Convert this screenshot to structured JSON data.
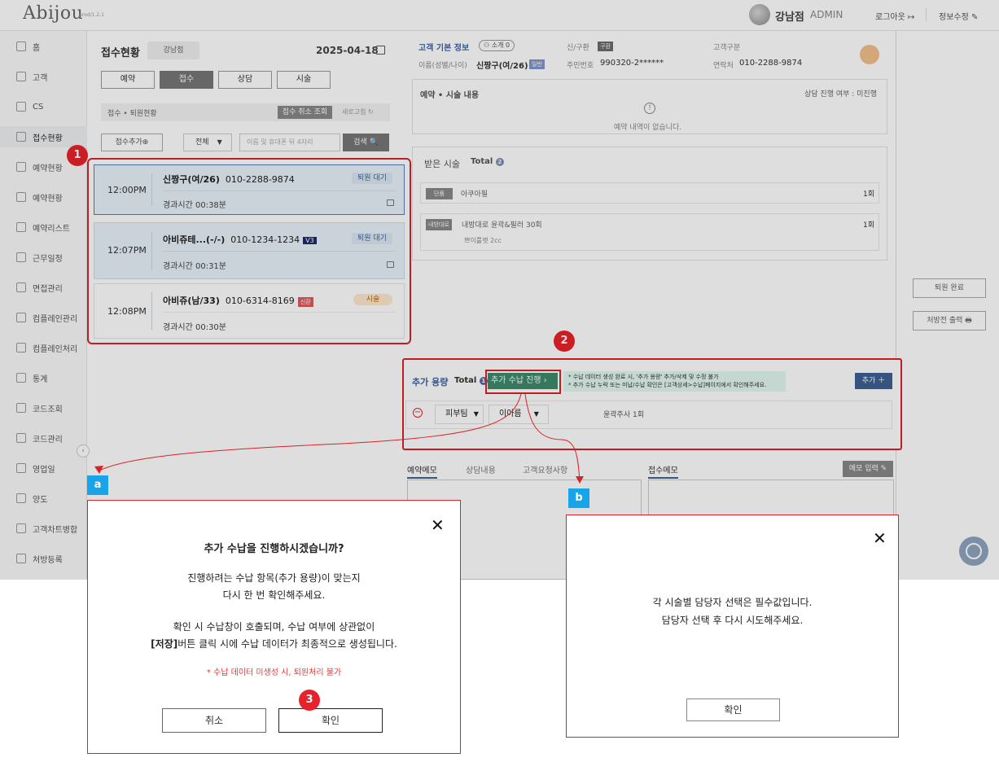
{
  "header": {
    "logo": "Abijou",
    "version": "prod/1.2.1",
    "branch_name": "강남점",
    "role": "ADMIN",
    "logout": "로그아웃 ↦",
    "edit_info": "정보수정 ✎"
  },
  "sidebar": {
    "items": [
      {
        "label": "홈"
      },
      {
        "label": "고객"
      },
      {
        "label": "CS"
      },
      {
        "label": "접수현황"
      },
      {
        "label": "예약현황"
      },
      {
        "label": "예약현황"
      },
      {
        "label": "예약리스트"
      },
      {
        "label": "근무일정"
      },
      {
        "label": "면접관리"
      },
      {
        "label": "컴플레인관리"
      },
      {
        "label": "컴플레인처리"
      },
      {
        "label": "통계"
      },
      {
        "label": "코드조회"
      },
      {
        "label": "코드관리"
      },
      {
        "label": "영업일"
      },
      {
        "label": "양도"
      },
      {
        "label": "고객차트병합"
      },
      {
        "label": "처방등록"
      }
    ],
    "active_index": 3,
    "collapse": "‹"
  },
  "reception": {
    "title": "접수현황",
    "branch": "강남점",
    "date": "2025-04-18",
    "tabs": [
      "예약",
      "접수",
      "상담",
      "시술"
    ],
    "selected_tab": 1,
    "strip_label": "접수 • 퇴원현황",
    "cancel_view": "접수 취소 조회",
    "refresh": "새로고침 ↻",
    "add": "접수추가⊕",
    "filter": "전체",
    "search_placeholder": "이름 및 휴대폰 뒤 4자리",
    "search": "검색 🔍",
    "cards": [
      {
        "time": "12:00PM",
        "name": "신짱구(여/26)",
        "phone": "010-2288-9874",
        "badge": "퇴원 대기",
        "elapsed": "경과시간 00:38분"
      },
      {
        "time": "12:07PM",
        "name": "아비쥬테...(-/-)",
        "phone": "010-1234-1234",
        "tag": "V3",
        "badge": "퇴원 대기",
        "elapsed": "경과시간 00:31분"
      },
      {
        "time": "12:08PM",
        "name": "아비쥬(남/33)",
        "phone": "010-6314-8169",
        "tag": "신환",
        "badge": "시술",
        "elapsed": "경과시간 00:30분"
      }
    ]
  },
  "customer": {
    "section_title": "고객 기본 정보",
    "referral": "소개 0",
    "new_old_label": "신/구환",
    "new_old_value": "구환",
    "type_label": "고객구분",
    "name_label": "이름(성별/나이)",
    "name_value": "신짱구(여/26)",
    "grade": "일반",
    "rrn_label": "주민번호",
    "rrn_value": "990320-2******",
    "contact_label": "연락처",
    "contact_value": "010-2288-9874"
  },
  "reservation": {
    "title": "예약 • 시술 내용",
    "consult_status": "상담 진행 여부 : 미진행",
    "empty": "예약 내역이 없습니다."
  },
  "received": {
    "title": "받은 시술",
    "total": "Total",
    "count": "2",
    "items": [
      {
        "tag": "단품",
        "name": "아쿠아필",
        "qty": "1회"
      },
      {
        "tag": "내방대로",
        "name": "내방대로 윤곽&필러 30회",
        "sub": "쁘이룰렛 2cc",
        "qty": "1회"
      }
    ]
  },
  "right_actions": {
    "discharge": "퇴원 완료",
    "prescription": "처방전 출력 🖶"
  },
  "extra": {
    "title": "추가 용량",
    "total": "Total",
    "count": "1",
    "pay_button": "추가 수납 진행 ›",
    "notice1": "* 수납 데이터 생성 완료 시, '추가 용량' 추가/삭제 및 수정 불가",
    "notice2": "* 추가 수납 누락 또는 미납/수납 확인은 [고객상세>수납]페이지에서 확인해주세요.",
    "add_button": "추가 ＋",
    "row": {
      "minus": "−",
      "treatment": "피부팀",
      "staff": "이아름",
      "item": "윤곽주사 1회"
    }
  },
  "memo": {
    "tabs": [
      "예약메모",
      "상담내용",
      "고객요청사항"
    ],
    "reception_memo": "접수메모",
    "memo_input": "메모 입력 ✎"
  },
  "markers": {
    "step1": "1",
    "step2": "2",
    "step3": "3",
    "a": "a",
    "b": "b"
  },
  "dialog_a": {
    "close": "✕",
    "title": "추가 수납을 진행하시겠습니까?",
    "line1": "진행하려는 수납 항목(추가 용량)이 맞는지",
    "line2": "다시 한 번 확인해주세요.",
    "line3": "확인 시 수납창이 호출되며, 수납 여부에 상관없이",
    "line4_bold": "[저장]",
    "line4_rest": "버튼 클릭 시에 수납 데이터가 최종적으로 생성됩니다.",
    "warning": "* 수납 데이터 미생성 시, 퇴원처리 불가",
    "cancel": "취소",
    "confirm": "확인"
  },
  "dialog_b": {
    "close": "✕",
    "line1": "각 시술별 담당자 선택은 필수값입니다.",
    "line2": "담당자 선택 후 다시 시도해주세요.",
    "confirm": "확인"
  },
  "colors": {
    "accent": "#3f6192",
    "callout": "#d8232a",
    "letter": "#18a4e8",
    "pay": "#3f8a6a"
  }
}
